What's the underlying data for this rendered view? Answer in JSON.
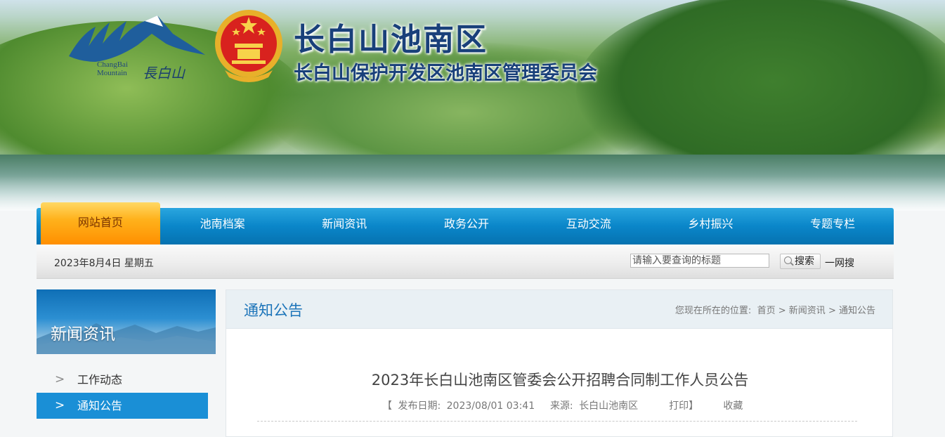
{
  "header": {
    "logo_en_line1": "ChangBai",
    "logo_en_line2": "Mountain",
    "logo_cn": "長白山",
    "title": "长白山池南区",
    "subtitle": "长白山保护开发区池南区管理委员会"
  },
  "nav": {
    "items": [
      "网站首页",
      "池南档案",
      "新闻资讯",
      "政务公开",
      "互动交流",
      "乡村振兴",
      "专题专栏"
    ],
    "active_index": 0
  },
  "toolbar": {
    "date": "2023年8月4日 星期五",
    "search_placeholder": "请输入要查询的标题",
    "search_button": "搜索",
    "global_search": "一网搜"
  },
  "sidebar": {
    "title": "新闻资讯",
    "items": [
      {
        "label": "工作动态"
      },
      {
        "label": "通知公告"
      }
    ],
    "arrow_glyph": ">",
    "active_index": 1
  },
  "content": {
    "section_title": "通知公告",
    "breadcrumb": {
      "prefix": "您现在所在的位置:",
      "items": [
        "首页",
        "新闻资讯",
        "通知公告"
      ],
      "separator": ">"
    },
    "article": {
      "title": "2023年长白山池南区管委会公开招聘合同制工作人员公告",
      "meta_open": "【",
      "date_label": "发布日期:",
      "date": "2023/08/01 03:41",
      "source_label": "来源:",
      "source": "长白山池南区",
      "print": "打印】",
      "favorite": "收藏"
    }
  },
  "colors": {
    "nav_blue": "#0a86c9",
    "nav_active": "#ffb21c",
    "title_blue": "#19407a",
    "accent": "#1a8fd6"
  }
}
